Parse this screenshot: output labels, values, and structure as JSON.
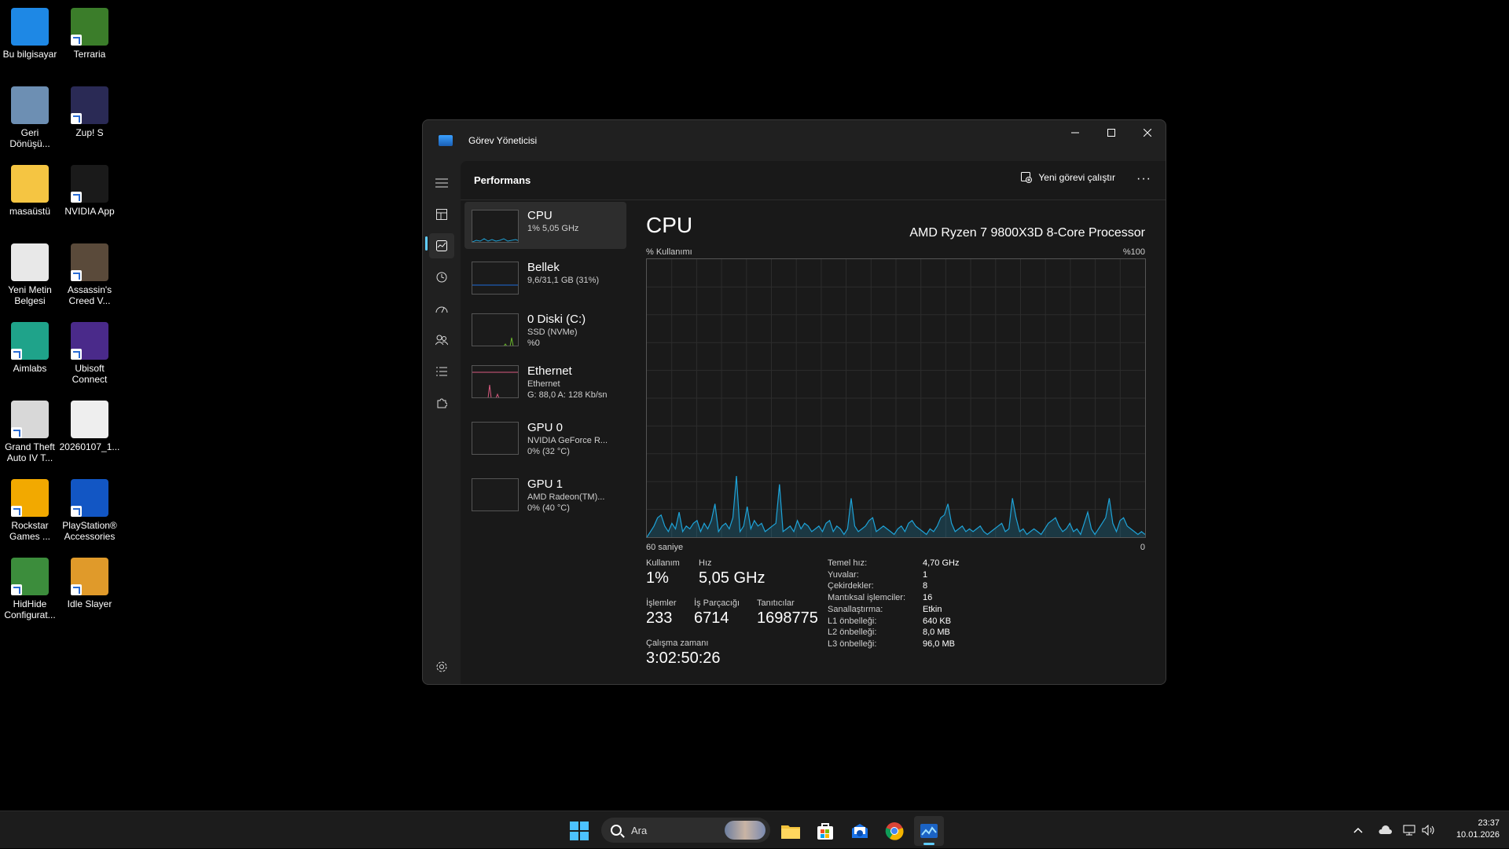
{
  "desktop_icons": [
    {
      "label": "Bu bilgisayar",
      "icon": "monitor-icon"
    },
    {
      "label": "Terraria",
      "icon": "tree-icon"
    },
    {
      "label": "Geri Dönüşü...",
      "icon": "recycle-bin-icon"
    },
    {
      "label": "Zup! S",
      "icon": "zup-icon"
    },
    {
      "label": "masaüstü",
      "icon": "folder-icon"
    },
    {
      "label": "NVIDIA App",
      "icon": "nvidia-icon"
    },
    {
      "label": "Yeni Metin Belgesi",
      "icon": "text-document-icon"
    },
    {
      "label": "Assassin's Creed V...",
      "icon": "assassins-creed-icon"
    },
    {
      "label": "Aimlabs",
      "icon": "aimlabs-icon"
    },
    {
      "label": "Ubisoft Connect",
      "icon": "ubisoft-icon"
    },
    {
      "label": "Grand Theft Auto IV T...",
      "icon": "gta-iv-icon"
    },
    {
      "label": "20260107_1...",
      "icon": "video-file-icon"
    },
    {
      "label": "Rockstar Games ...",
      "icon": "rockstar-icon"
    },
    {
      "label": "PlayStation® Accessories",
      "icon": "playstation-icon"
    },
    {
      "label": "HidHide Configurat...",
      "icon": "hidhide-icon"
    },
    {
      "label": "Idle Slayer",
      "icon": "idle-slayer-icon"
    }
  ],
  "window": {
    "title": "Görev Yöneticisi",
    "section_title": "Performans",
    "run_task_label": "Yeni görevi çalıştır",
    "more_label": "···"
  },
  "devices": [
    {
      "name": "CPU",
      "lines": [
        "1%  5,05 GHz"
      ]
    },
    {
      "name": "Bellek",
      "lines": [
        "9,6/31,1 GB (31%)"
      ]
    },
    {
      "name": "0 Diski (C:)",
      "lines": [
        "SSD (NVMe)",
        "%0"
      ]
    },
    {
      "name": "Ethernet",
      "lines": [
        "Ethernet",
        "G: 88,0  A: 128 Kb/sn"
      ]
    },
    {
      "name": "GPU 0",
      "lines": [
        "NVIDIA GeForce R...",
        "0%  (32 °C)"
      ]
    },
    {
      "name": "GPU 1",
      "lines": [
        "AMD Radeon(TM)...",
        "0%  (40 °C)"
      ]
    }
  ],
  "cpu": {
    "title": "CPU",
    "processor": "AMD Ryzen 7 9800X3D 8-Core Processor",
    "usage_label": "% Kullanımı",
    "max_label": "%100",
    "time_left": "60 saniye",
    "time_right": "0",
    "stats": {
      "usage_lbl": "Kullanım",
      "usage": "1%",
      "speed_lbl": "Hız",
      "speed": "5,05 GHz",
      "processes_lbl": "İşlemler",
      "processes": "233",
      "threads_lbl": "İş Parçacığı",
      "threads": "6714",
      "handles_lbl": "Tanıtıcılar",
      "handles": "1698775",
      "uptime_lbl": "Çalışma zamanı",
      "uptime": "3:02:50:26"
    },
    "specs": [
      {
        "k": "Temel hız:",
        "v": "4,70 GHz"
      },
      {
        "k": "Yuvalar:",
        "v": "1"
      },
      {
        "k": "Çekirdekler:",
        "v": "8"
      },
      {
        "k": "Mantıksal işlemciler:",
        "v": "16"
      },
      {
        "k": "Sanallaştırma:",
        "v": "Etkin"
      },
      {
        "k": "L1 önbelleği:",
        "v": "640 KB"
      },
      {
        "k": "L2 önbelleği:",
        "v": "8,0 MB"
      },
      {
        "k": "L3 önbelleği:",
        "v": "96,0 MB"
      }
    ],
    "graph_series": [
      0,
      2,
      4,
      7,
      8,
      4,
      2,
      5,
      3,
      9,
      2,
      4,
      3,
      5,
      6,
      2,
      5,
      3,
      6,
      12,
      2,
      4,
      5,
      3,
      7,
      22,
      2,
      4,
      11,
      3,
      6,
      4,
      5,
      2,
      3,
      4,
      5,
      19,
      2,
      3,
      4,
      2,
      6,
      3,
      5,
      4,
      2,
      3,
      4,
      2,
      5,
      6,
      2,
      4,
      3,
      1,
      3,
      14,
      4,
      2,
      3,
      4,
      6,
      7,
      2,
      3,
      4,
      3,
      2,
      1,
      3,
      4,
      2,
      5,
      6,
      4,
      3,
      2,
      1,
      3,
      2,
      4,
      7,
      8,
      12,
      5,
      2,
      3,
      4,
      2,
      3,
      2,
      3,
      4,
      2,
      1,
      2,
      3,
      4,
      5,
      2,
      3,
      14,
      7,
      2,
      3,
      1,
      2,
      3,
      2,
      1,
      3,
      5,
      6,
      7,
      4,
      2,
      3,
      5,
      2,
      3,
      1,
      5,
      9,
      3,
      1,
      3,
      5,
      7,
      14,
      5,
      2,
      6,
      7,
      4,
      3,
      2,
      1,
      2,
      1
    ]
  },
  "taskbar": {
    "search_placeholder": "Ara",
    "time": "23:37",
    "date": "10.01.2026"
  },
  "colors": {
    "accent": "#60cdff",
    "cpu_line": "#1ea3d8",
    "memory_line": "#1e6bd8",
    "disk_line": "#6ab82b",
    "ethernet_line": "#d85a7f",
    "gpu_line": "#a35ad8"
  }
}
